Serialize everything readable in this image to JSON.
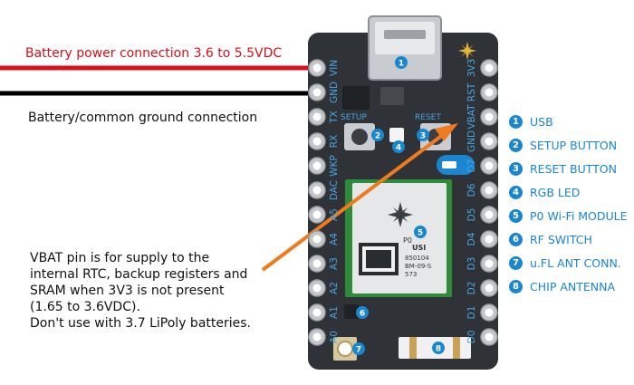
{
  "annotations": {
    "battery_power": "Battery power connection 3.6 to 5.5VDC",
    "battery_ground": "Battery/common ground connection",
    "vbat_note": [
      "VBAT pin is for supply to the",
      "internal RTC, backup registers and",
      "SRAM when 3V3 is not present",
      "(1.65 to 3.6VDC).",
      "Don't use with 3.7 LiPoly batteries."
    ]
  },
  "board": {
    "left_pins": [
      "VIN",
      "GND",
      "TX",
      "RX",
      "WKP",
      "DAC",
      "A5",
      "A4",
      "A3",
      "A2",
      "A1",
      "A0"
    ],
    "right_pins": [
      "3V3",
      "RST",
      "VBAT",
      "GND",
      "D7",
      "D6",
      "D5",
      "D4",
      "D3",
      "D2",
      "D1",
      "D0"
    ],
    "setup_label": "SETUP",
    "reset_label": "RESET",
    "module_name": "P0",
    "module_brand": "USI",
    "module_code_lines": [
      "850104",
      "BM-09-S",
      "573"
    ]
  },
  "legend": [
    {
      "num": "1",
      "label": "USB"
    },
    {
      "num": "2",
      "label": "SETUP BUTTON"
    },
    {
      "num": "3",
      "label": "RESET BUTTON"
    },
    {
      "num": "4",
      "label": "RGB LED"
    },
    {
      "num": "5",
      "label": "P0 Wi-Fi MODULE"
    },
    {
      "num": "6",
      "label": "RF SWITCH"
    },
    {
      "num": "7",
      "label": "u.FL ANT CONN."
    },
    {
      "num": "8",
      "label": "CHIP ANTENNA"
    }
  ],
  "colors": {
    "board": "#2f3337",
    "accent_blue": "#1a86d0",
    "power_wire": "#d8101a",
    "ground_wire": "#000000",
    "arrow": "#f07a1e"
  }
}
